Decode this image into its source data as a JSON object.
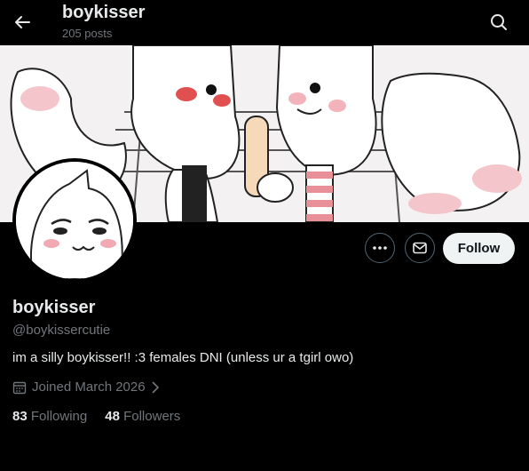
{
  "header": {
    "title": "boykisser",
    "posts": "205 posts",
    "back_icon": "arrow-left-icon",
    "search_icon": "search-icon"
  },
  "profile": {
    "display_name": "boykisser",
    "handle": "@boykissercutie",
    "bio": "im a silly boykisser!! :3 females DNI (unless ur a tgirl owo)",
    "joined": "Joined March 2026",
    "following_count": "83",
    "following_label": "Following",
    "followers_count": "48",
    "followers_label": "Followers"
  },
  "actions": {
    "more_icon": "more-icon",
    "message_icon": "envelope-icon",
    "follow_label": "Follow"
  },
  "colors": {
    "background": "#000000",
    "text_primary": "#e7e9ea",
    "text_secondary": "#71767b",
    "follow_button": "#eff3f4",
    "blush": "#e8a0a8"
  }
}
